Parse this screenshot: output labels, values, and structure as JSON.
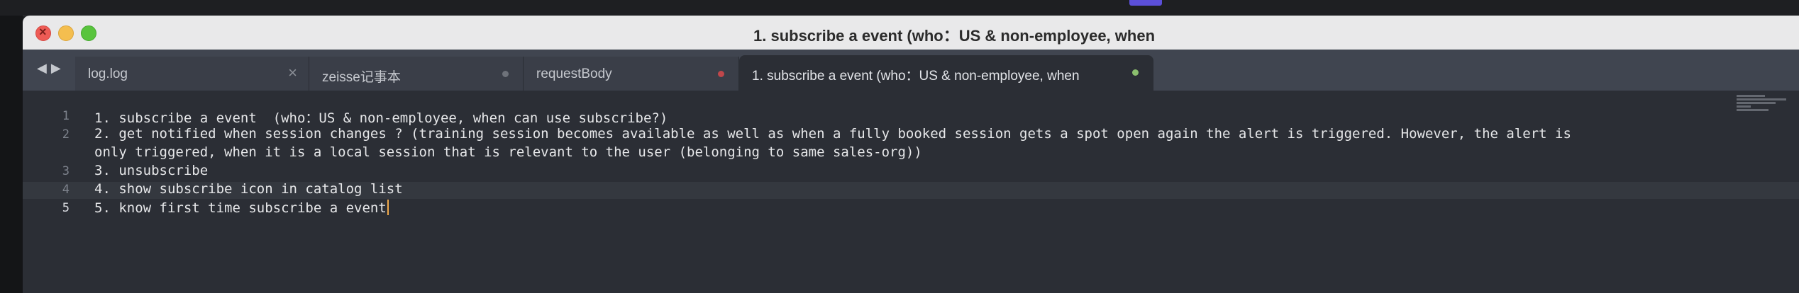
{
  "window": {
    "title": "1. subscribe a event  (who：US & non-employee, when"
  },
  "tabs": [
    {
      "label": "log.log",
      "indicator": "close",
      "indicator_glyph": "×"
    },
    {
      "label": "zeisse记事本",
      "indicator": "dirty-dot",
      "dot_color": "#6e727a"
    },
    {
      "label": "requestBody",
      "indicator": "dirty-dot",
      "dot_color": "#c0474b"
    },
    {
      "label": "1. subscribe a event  (who：US & non-employee, when",
      "indicator": "dirty-dot",
      "dot_color": "#8bbf6e",
      "active": true
    }
  ],
  "nav": {
    "back_glyph": "◀",
    "forward_glyph": "▶"
  },
  "editor": {
    "current_line": "5",
    "lines": [
      {
        "no": "1",
        "text": "1. subscribe a event  (who：US & non-employee, when can use subscribe?)"
      },
      {
        "no": "2",
        "text": "2. get notified when session changes ? (training session becomes available as well as when a fully booked session gets a spot open again the alert is triggered. However, the alert is"
      },
      {
        "no": "",
        "text": "only triggered, when it is a local session that is relevant to the user (belonging to same sales-org))"
      },
      {
        "no": "3",
        "text": "3. unsubscribe"
      },
      {
        "no": "4",
        "text": "4. show subscribe icon in catalog list"
      },
      {
        "no": "5",
        "text": "5. know first time subscribe a event"
      }
    ]
  },
  "colors": {
    "caret": "#f0a94b",
    "editor_bg": "#2b2e35",
    "tabbar_bg": "#404550"
  }
}
